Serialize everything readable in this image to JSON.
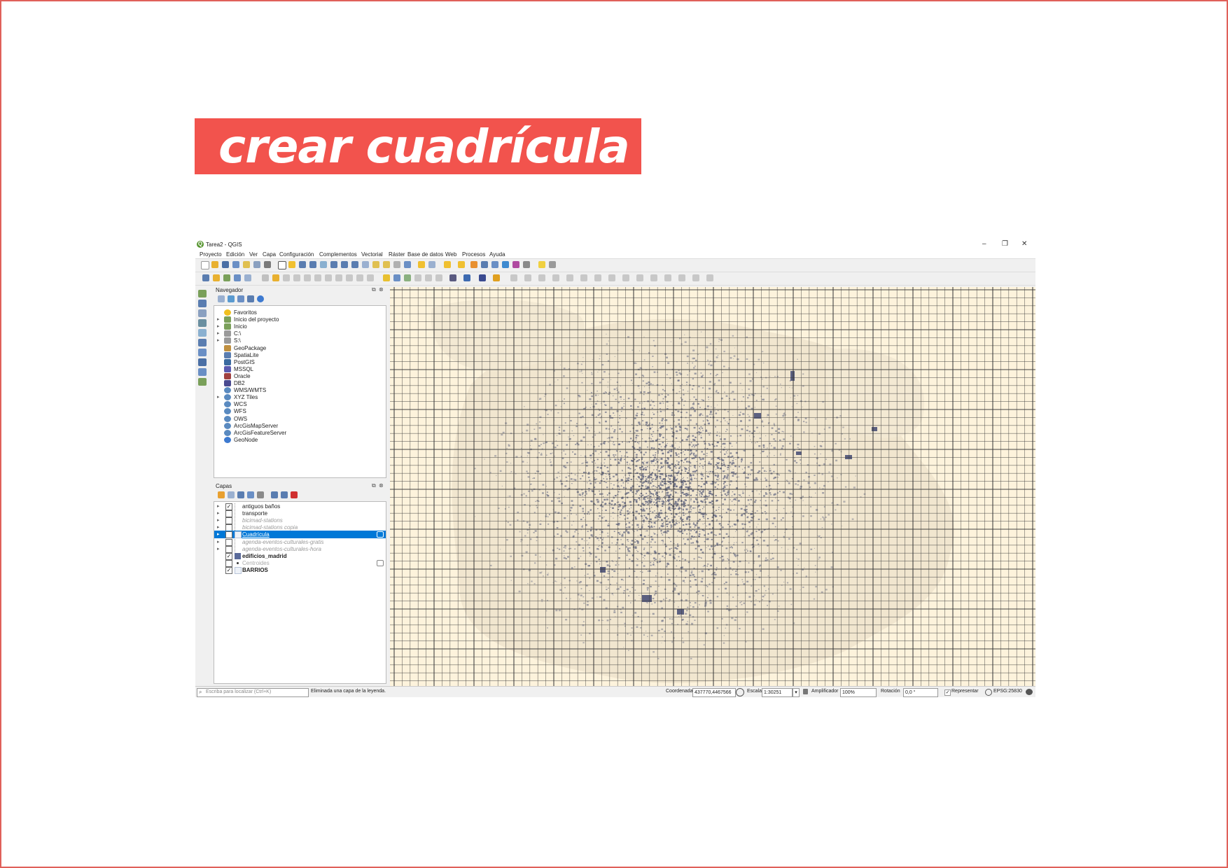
{
  "slide": {
    "heading": "crear cuadrícula"
  },
  "window": {
    "title": "Tarea2 - QGIS",
    "controls": [
      "–",
      "❐",
      "✕"
    ]
  },
  "menu": [
    "Proyecto",
    "Edición",
    "Ver",
    "Capa",
    "Configuración",
    "Complementos",
    "Vectorial",
    "Ráster",
    "Base de datos",
    "Web",
    "Procesos",
    "Ayuda"
  ],
  "browser": {
    "title": "Navegador",
    "items": [
      {
        "label": "Favoritos",
        "icon": "star-icon",
        "expandable": false
      },
      {
        "label": "Inicio del proyecto",
        "icon": "folder-icon",
        "expandable": true
      },
      {
        "label": "Inicio",
        "icon": "folder-icon",
        "expandable": true
      },
      {
        "label": "C:\\",
        "icon": "drive-icon",
        "expandable": true
      },
      {
        "label": "S:\\",
        "icon": "drive-icon",
        "expandable": true
      },
      {
        "label": "GeoPackage",
        "icon": "geopackage-icon",
        "expandable": false
      },
      {
        "label": "SpatiaLite",
        "icon": "spatialite-icon",
        "expandable": false
      },
      {
        "label": "PostGIS",
        "icon": "postgis-icon",
        "expandable": false
      },
      {
        "label": "MSSQL",
        "icon": "mssql-icon",
        "expandable": false
      },
      {
        "label": "Oracle",
        "icon": "oracle-icon",
        "expandable": false
      },
      {
        "label": "DB2",
        "icon": "db2-icon",
        "expandable": false
      },
      {
        "label": "WMS/WMTS",
        "icon": "globe-icon",
        "expandable": false
      },
      {
        "label": "XYZ Tiles",
        "icon": "globe-icon",
        "expandable": true
      },
      {
        "label": "WCS",
        "icon": "globe-icon",
        "expandable": false
      },
      {
        "label": "WFS",
        "icon": "globe-icon",
        "expandable": false
      },
      {
        "label": "OWS",
        "icon": "globe-icon",
        "expandable": false
      },
      {
        "label": "ArcGisMapServer",
        "icon": "globe-icon",
        "expandable": false
      },
      {
        "label": "ArcGisFeatureServer",
        "icon": "globe-icon",
        "expandable": false
      },
      {
        "label": "GeoNode",
        "icon": "geonode-icon",
        "expandable": false
      }
    ]
  },
  "layers": {
    "title": "Capas",
    "items": [
      {
        "label": "antiguos baños",
        "checked": true,
        "expandable": true,
        "style": "normal",
        "symbol": "point",
        "selected": false
      },
      {
        "label": "transporte",
        "checked": false,
        "expandable": true,
        "style": "normal",
        "symbol": "point",
        "selected": false
      },
      {
        "label": "bicimad-stations",
        "checked": false,
        "expandable": true,
        "style": "italic",
        "symbol": "point",
        "selected": false
      },
      {
        "label": "bicimad-stations copia",
        "checked": false,
        "expandable": true,
        "style": "italic",
        "symbol": "point",
        "selected": false
      },
      {
        "label": "Cuadrícula",
        "checked": true,
        "expandable": true,
        "style": "normal",
        "symbol": "polygon-light",
        "selected": true
      },
      {
        "label": "agenda-eventos-culturales-gratis",
        "checked": false,
        "expandable": true,
        "style": "italic",
        "symbol": "point",
        "selected": false
      },
      {
        "label": "agenda-eventos-culturales-hora",
        "checked": false,
        "expandable": true,
        "style": "italic",
        "symbol": "point",
        "selected": false
      },
      {
        "label": "edificios_madrid",
        "checked": true,
        "expandable": false,
        "style": "bold",
        "symbol": "polygon-dark",
        "selected": false
      },
      {
        "label": "Centroides",
        "checked": false,
        "expandable": false,
        "style": "gray",
        "symbol": "dot",
        "selected": false
      },
      {
        "label": "BARRIOS",
        "checked": true,
        "expandable": false,
        "style": "bold",
        "symbol": "polygon-light",
        "selected": false
      }
    ]
  },
  "status": {
    "search_placeholder": "Escriba para localizar (Ctrl+K)",
    "message": "Eliminada una capa de la leyenda.",
    "coord_label": "Coordenada",
    "coord_value": "437770,4467566",
    "scale_label": "Escala",
    "scale_value": "1:30251",
    "magnifier_label": "Amplificador",
    "magnifier_value": "100%",
    "rotation_label": "Rotación",
    "rotation_value": "0,0 °",
    "render_label": "Representar",
    "crs": "EPSG:25830"
  },
  "colors": {
    "accent": "#f2534d",
    "map_bg": "#fdf3dc",
    "grid": "#3a3a3a",
    "buildings": "#6b6f86",
    "selection": "#0078d7"
  }
}
